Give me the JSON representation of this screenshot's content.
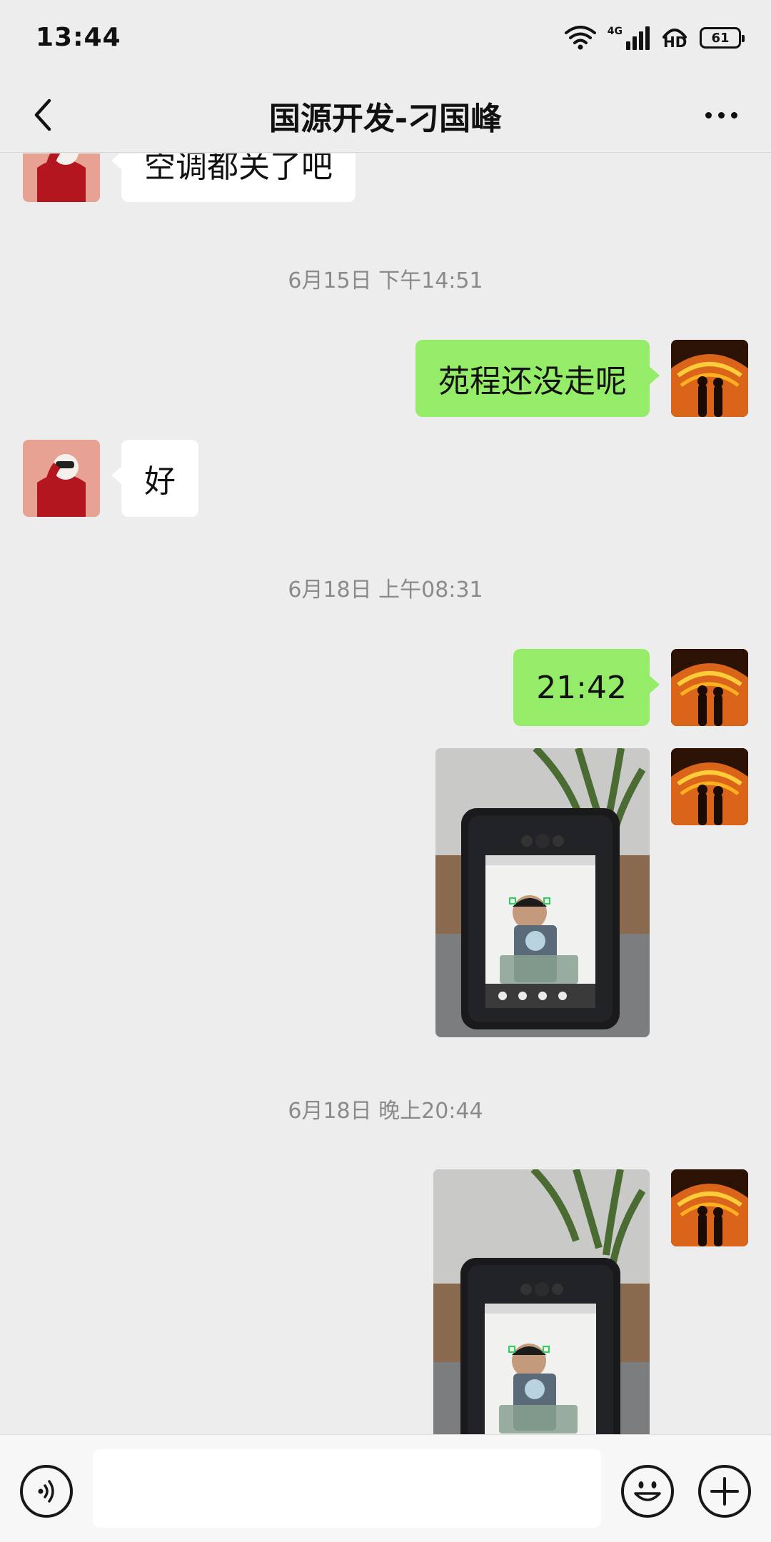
{
  "status_bar": {
    "time": "13:44",
    "network": "4G",
    "hd": "HD",
    "battery": "61"
  },
  "nav": {
    "title": "国源开发-刁国峰",
    "back_icon": "chevron-left-icon",
    "more_icon": "more-dots-icon"
  },
  "messages": [
    {
      "type": "text",
      "side": "left",
      "text": "空调都关了吧"
    },
    {
      "type": "timestamp",
      "text": "6月15日 下午14:51"
    },
    {
      "type": "text",
      "side": "right",
      "text": "苑程还没走呢"
    },
    {
      "type": "text",
      "side": "left",
      "text": "好"
    },
    {
      "type": "timestamp",
      "text": "6月18日 上午08:31"
    },
    {
      "type": "text",
      "side": "right",
      "text": "21:42"
    },
    {
      "type": "image",
      "side": "right"
    },
    {
      "type": "timestamp",
      "text": "6月18日 晚上20:44"
    },
    {
      "type": "image",
      "side": "right"
    }
  ],
  "input_bar": {
    "voice_icon": "voice-icon",
    "input_value": "",
    "emoji_icon": "emoji-icon",
    "plus_icon": "plus-icon"
  },
  "colors": {
    "background": "#ededed",
    "bubble_self": "#95ec69",
    "bubble_other": "#ffffff",
    "timestamp": "#8a8a8a"
  }
}
